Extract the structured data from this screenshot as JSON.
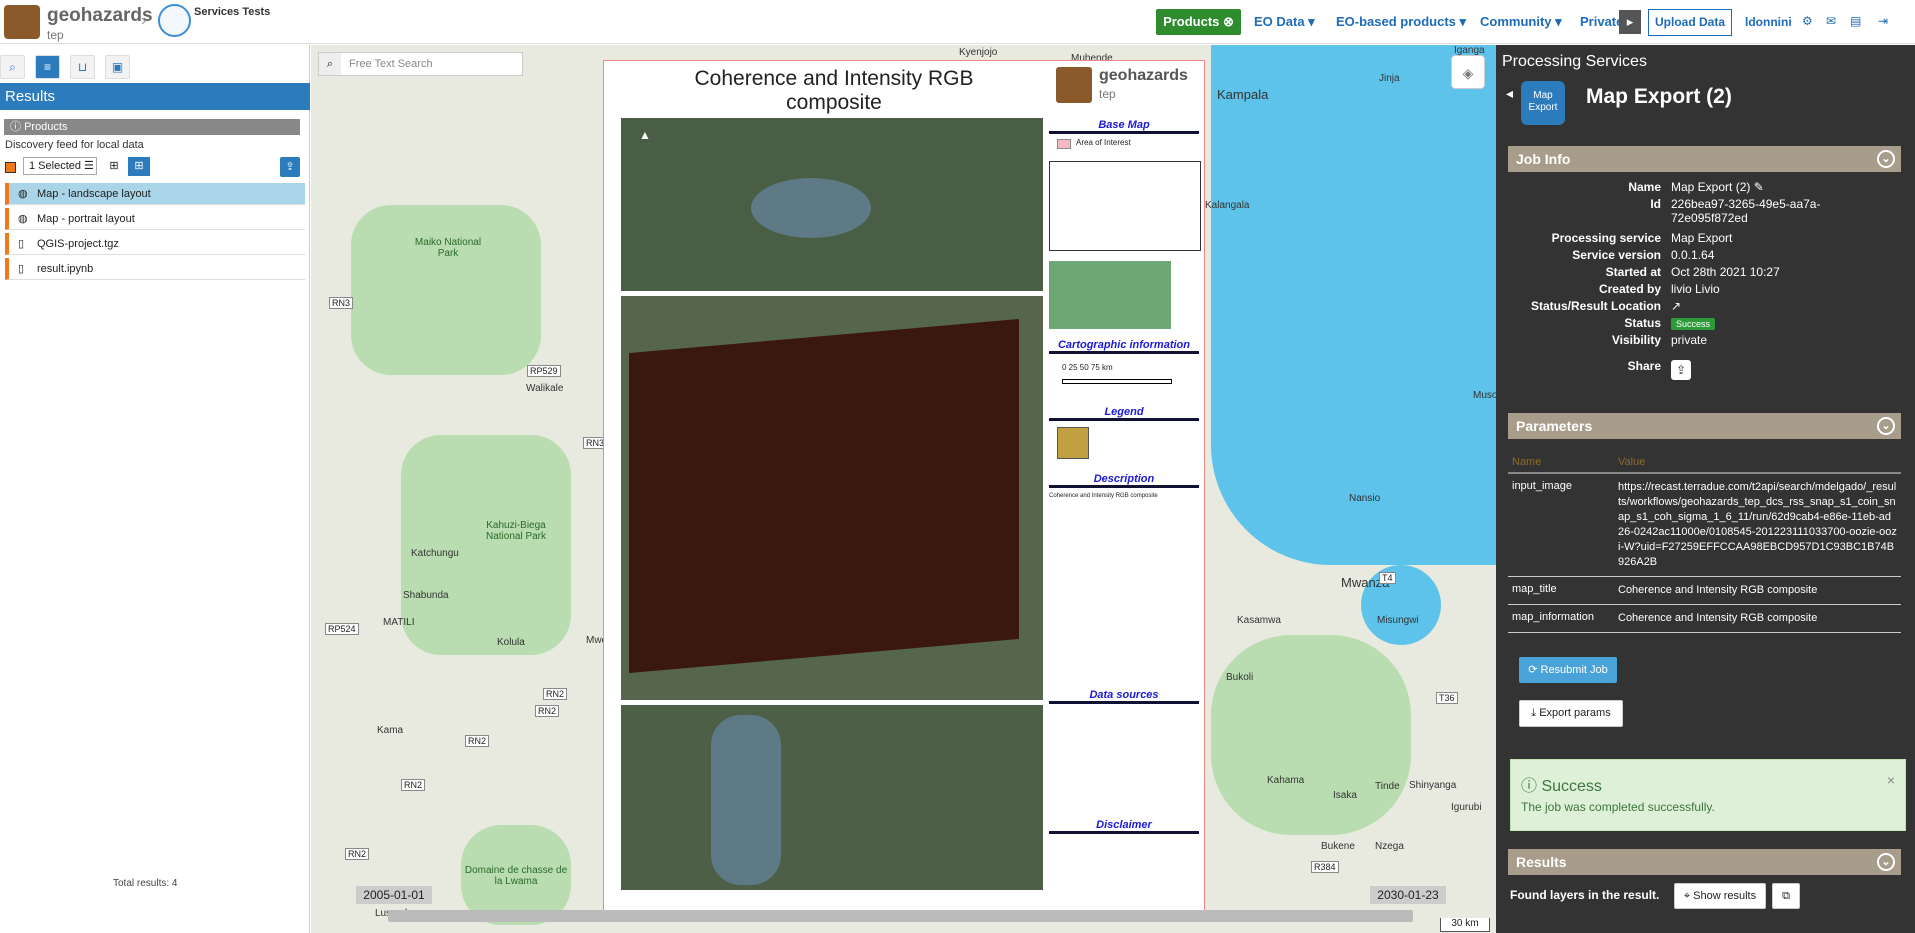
{
  "header": {
    "logo_text": "geohazards",
    "logo_sub": "tep",
    "breadcrumb": "Services Tests",
    "products_label": "Products",
    "nav": [
      "EO Data ▾",
      "EO-based products ▾",
      "Community ▾",
      "Private"
    ],
    "upload_label": "Upload Data",
    "user": "ldonnini",
    "icons": [
      "gear-icon",
      "envelope-icon",
      "book-icon",
      "signout-icon"
    ]
  },
  "left": {
    "title": "Results",
    "products_header": "Products",
    "discovery": "Discovery feed for local data",
    "selected": "1 Selected",
    "items": [
      {
        "label": "Map - landscape layout",
        "icon": "globe-icon",
        "selected": true
      },
      {
        "label": "Map - portrait layout",
        "icon": "globe-icon",
        "selected": false
      },
      {
        "label": "QGIS-project.tgz",
        "icon": "file-icon",
        "selected": false
      },
      {
        "label": "result.ipynb",
        "icon": "file-icon",
        "selected": false
      }
    ],
    "total": "Total results: 4"
  },
  "map": {
    "search_placeholder": "Free Text Search",
    "timeline_start": "2005-01-01",
    "timeline_end": "2030-01-23",
    "scale": "30 km",
    "labels": [
      "Kyenjojo",
      "Mubende",
      "Kampala",
      "Jinja",
      "Iganga",
      "Kalangala",
      "Maiko National Park",
      "Walikale",
      "Kahuzi-Biega National Park",
      "Katchungu",
      "Shabunda",
      "MATILI",
      "Kolula",
      "Mwenga",
      "Kama",
      "Domaine de chasse de la Lwama",
      "Lusambo",
      "Nansio",
      "Mwanza",
      "Misungwi",
      "Kasamwa",
      "Bukoli",
      "Shinyanga",
      "Kahama",
      "Isaka",
      "Tinde",
      "Nzega",
      "Bukene",
      "Igurubi",
      "Musoma"
    ],
    "roads": [
      "RN3",
      "RP529",
      "RN3",
      "RP524",
      "RN2",
      "RN2",
      "RN2",
      "RN2",
      "RN2",
      "T4",
      "T36",
      "R384"
    ],
    "doc": {
      "title": "Coherence and Intensity RGB composite",
      "logo_text": "geohazards",
      "logo_sub": "tep",
      "base_map": "Base Map",
      "aoi": "Area of Interest",
      "carto": "Cartographic information",
      "scale_ticks": "0   25   50   75 km",
      "legend": "Legend",
      "description": "Description",
      "desc_text": "Coherence and Intensity RGB composite",
      "data_sources": "Data sources",
      "disclaimer": "Disclaimer"
    }
  },
  "right": {
    "section_title": "Processing Services",
    "icon_text": "Map Export",
    "title": "Map Export (2)",
    "job_info": "Job Info",
    "job": [
      {
        "label": "Name",
        "value": "Map Export (2) ✎"
      },
      {
        "label": "Id",
        "value": "226bea97-3265-49e5-aa7a-72e095f872ed"
      },
      {
        "label": "Processing service",
        "value": "Map Export"
      },
      {
        "label": "Service version",
        "value": "0.0.1.64"
      },
      {
        "label": "Started at",
        "value": "Oct 28th 2021 10:27"
      },
      {
        "label": "Created by",
        "value": "livio Livio"
      },
      {
        "label": "Status/Result Location",
        "value": "↗"
      },
      {
        "label": "Status",
        "value": "Success"
      },
      {
        "label": "Visibility",
        "value": "private"
      },
      {
        "label": "Share",
        "value": ""
      }
    ],
    "parameters": "Parameters",
    "param_cols": [
      "Name",
      "Value"
    ],
    "params": [
      {
        "name": "input_image",
        "value": "https://recast.terradue.com/t2api/search/mdelgado/_results/workflows/geohazards_tep_dcs_rss_snap_s1_coin_snap_s1_coh_sigma_1_6_11/run/62d9cab4-e86e-11eb-ad26-0242ac11000e/0108545-201223111033700-oozie-oozi-W?uid=F27259EFFCCAA98EBCD957D1C93BC1B74B926A2B"
      },
      {
        "name": "map_title",
        "value": "Coherence and Intensity RGB composite"
      },
      {
        "name": "map_information",
        "value": "Coherence and Intensity RGB composite"
      }
    ],
    "resubmit": "Resubmit Job",
    "export": "Export params",
    "success_title": "Success",
    "success_msg": "The job was completed successfully.",
    "results": "Results",
    "found": "Found layers in the result.",
    "show_results": "Show results"
  }
}
